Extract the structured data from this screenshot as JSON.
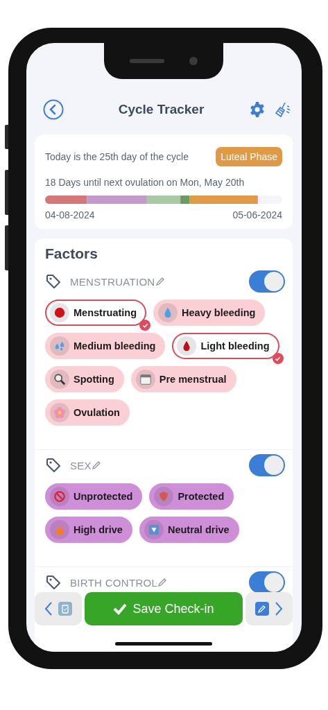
{
  "header": {
    "title": "Cycle Tracker"
  },
  "cycle": {
    "day_text": "Today is the 25th day of the cycle",
    "phase": "Luteal Phase",
    "ovulation_text": "18 Days until next ovulation on Mon, May 20th",
    "start_date": "04-08-2024",
    "end_date": "05-06-2024"
  },
  "factors": {
    "title": "Factors",
    "sections": [
      {
        "name": "MENSTRUATION",
        "on": true,
        "color": "#fbd0d5",
        "chips": [
          {
            "label": "Menstruating",
            "selected": true
          },
          {
            "label": "Heavy bleeding",
            "selected": false
          },
          {
            "label": "Medium bleeding",
            "selected": false
          },
          {
            "label": "Light bleeding",
            "selected": true
          },
          {
            "label": "Spotting",
            "selected": false
          },
          {
            "label": "Pre menstrual",
            "selected": false
          },
          {
            "label": "Ovulation",
            "selected": false
          }
        ]
      },
      {
        "name": "SEX",
        "on": true,
        "color": "#cf8fd8",
        "chips": [
          {
            "label": "Unprotected",
            "selected": false
          },
          {
            "label": "Protected",
            "selected": false
          },
          {
            "label": "High drive",
            "selected": false
          },
          {
            "label": "Neutral drive",
            "selected": false
          }
        ]
      },
      {
        "name": "BIRTH CONTROL",
        "on": true
      }
    ]
  },
  "save_button": "Save Check-in"
}
